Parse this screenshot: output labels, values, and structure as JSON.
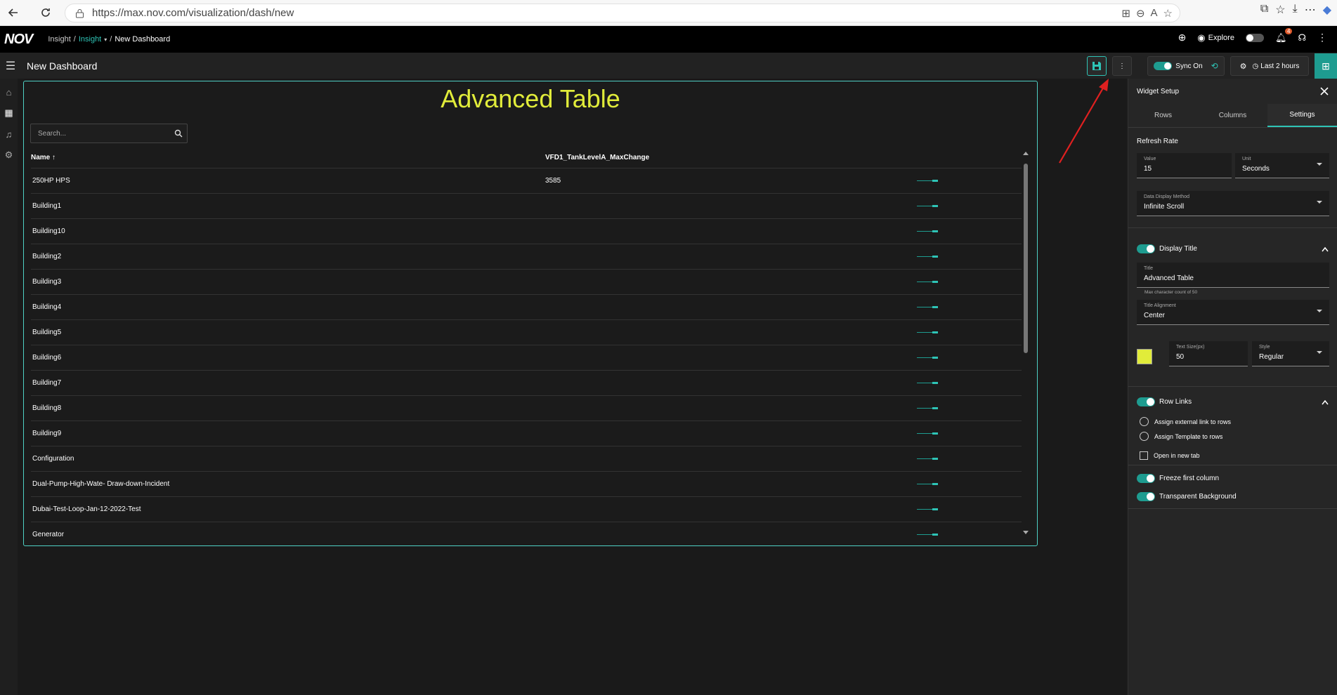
{
  "browser": {
    "url": "https://max.nov.com/visualization/dash/new"
  },
  "app": {
    "logo": "NOV",
    "breadcrumb": [
      "Insight",
      "/",
      "Insight",
      "/",
      "New Dashboard"
    ],
    "explore_label": "Explore",
    "notification_count": "4"
  },
  "toolbar": {
    "title": "New Dashboard",
    "sync_label": "Sync On",
    "time_label": "Last 2 hours"
  },
  "widget": {
    "title": "Advanced Table",
    "title_color": "#e1ec3a",
    "search_placeholder": "Search...",
    "columns": [
      "Name",
      "VFD1_TankLevelA_MaxChange"
    ],
    "sort_indicator": "↑",
    "rows": [
      {
        "name": "250HP HPS",
        "value": "3585"
      },
      {
        "name": "Building1",
        "value": ""
      },
      {
        "name": "Building10",
        "value": ""
      },
      {
        "name": "Building2",
        "value": ""
      },
      {
        "name": "Building3",
        "value": ""
      },
      {
        "name": "Building4",
        "value": ""
      },
      {
        "name": "Building5",
        "value": ""
      },
      {
        "name": "Building6",
        "value": ""
      },
      {
        "name": "Building7",
        "value": ""
      },
      {
        "name": "Building8",
        "value": ""
      },
      {
        "name": "Building9",
        "value": ""
      },
      {
        "name": "Configuration",
        "value": ""
      },
      {
        "name": "Dual-Pump-High-Wate- Draw-down-Incident",
        "value": ""
      },
      {
        "name": "Dubai-Test-Loop-Jan-12-2022-Test",
        "value": ""
      },
      {
        "name": "Generator",
        "value": ""
      }
    ]
  },
  "panel": {
    "header": "Widget Setup",
    "tabs": [
      "Rows",
      "Columns",
      "Settings"
    ],
    "active_tab": "Settings",
    "refresh_rate_label": "Refresh Rate",
    "value_label": "Value",
    "value": "15",
    "unit_label": "Unit",
    "unit": "Seconds",
    "display_method_label": "Data Display Method",
    "display_method": "Infinite Scroll",
    "display_title_label": "Display Title",
    "title_label": "Title",
    "title_value": "Advanced Table",
    "title_hint": "Max character count of 50",
    "alignment_label": "Title Alignment",
    "alignment_value": "Center",
    "text_size_label": "Text Size(px)",
    "text_size_value": "50",
    "style_label": "Style",
    "style_value": "Regular",
    "row_links_label": "Row Links",
    "assign_external": "Assign external link to rows",
    "assign_template": "Assign Template to rows",
    "open_new_tab": "Open in new tab",
    "freeze_first": "Freeze first column",
    "transparent_bg": "Transparent Background"
  }
}
